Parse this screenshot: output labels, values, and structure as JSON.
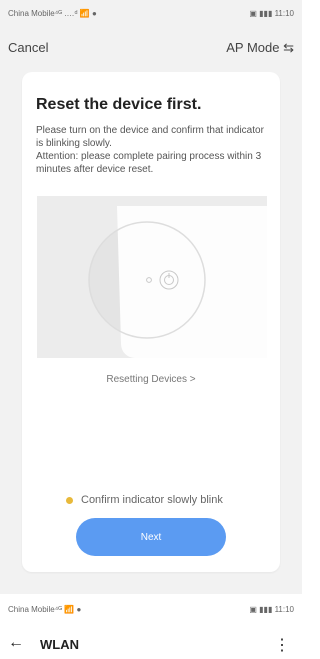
{
  "top_status": {
    "carrier": "China Mobile⁴ᴳ .…ᵈ 📶 ●",
    "time": "▣ ▮▮▮ 11:10"
  },
  "nav": {
    "cancel_label": "Cancel",
    "ap_mode_label": "AP Mode ⇆"
  },
  "card": {
    "title": "Reset the device first.",
    "description": "Please turn on the device and confirm that indicator is blinking slowly.\nAttention: please complete pairing process within 3 minutes after device reset.",
    "resetting_link": "Resetting Devices >",
    "confirm_label": "Confirm indicator slowly blink",
    "next_label": "Next"
  },
  "bottom_status": {
    "carrier": "China Mobile⁴ᴳ 📶 ●",
    "time": "▣ ▮▮▮ 11:10"
  },
  "wlan_bar": {
    "back_icon": "←",
    "title": "WLAN",
    "more_icon": "⋮"
  },
  "colors": {
    "accent": "#5b9bf2",
    "confirm_dot": "#e8b93a"
  }
}
